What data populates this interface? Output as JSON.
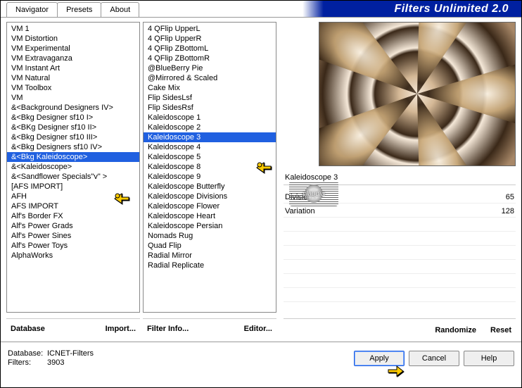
{
  "app": {
    "title": "Filters Unlimited 2.0"
  },
  "tabs": [
    "Navigator",
    "Presets",
    "About"
  ],
  "activeTab": 0,
  "categories": [
    "VM 1",
    "VM Distortion",
    "VM Experimental",
    "VM Extravaganza",
    "VM Instant Art",
    "VM Natural",
    "VM Toolbox",
    "VM",
    "&<Background Designers IV>",
    "&<Bkg Designer sf10 I>",
    "&<BKg Designer sf10 II>",
    "&<Bkg Designer sf10 III>",
    "&<Bkg Designers sf10 IV>",
    "&<Bkg Kaleidoscope>",
    "&<Kaleidoscope>",
    "&<Sandflower Specials\"v\" >",
    "[AFS IMPORT]",
    "AFH",
    "AFS IMPORT",
    "Alf's Border FX",
    "Alf's Power Grads",
    "Alf's Power Sines",
    "Alf's Power Toys",
    "AlphaWorks"
  ],
  "selectedCategoryIndex": 13,
  "filters": [
    "4 QFlip UpperL",
    "4 QFlip UpperR",
    "4 QFlip ZBottomL",
    "4 QFlip ZBottomR",
    "@BlueBerry Pie",
    "@Mirrored & Scaled",
    "Cake Mix",
    "Flip SidesLsf",
    "Flip SidesRsf",
    "Kaleidoscope 1",
    "Kaleidoscope 2",
    "Kaleidoscope 3",
    "Kaleidoscope 4",
    "Kaleidoscope 5",
    "Kaleidoscope 8",
    "Kaleidoscope 9",
    "Kaleidoscope Butterfly",
    "Kaleidoscope Divisions",
    "Kaleidoscope Flower",
    "Kaleidoscope Heart",
    "Kaleidoscope Persian",
    "Nomads Rug",
    "Quad Flip",
    "Radial Mirror",
    "Radial Replicate"
  ],
  "selectedFilterIndex": 11,
  "currentFilterLabel": "Kaleidoscope 3",
  "params": [
    {
      "name": "Divisions",
      "value": "65"
    },
    {
      "name": "Variation",
      "value": "128"
    }
  ],
  "emptyParamRows": 6,
  "buttons": {
    "database": "Database",
    "import": "Import...",
    "filterInfo": "Filter Info...",
    "editor": "Editor...",
    "randomize": "Randomize",
    "reset": "Reset",
    "apply": "Apply",
    "cancel": "Cancel",
    "help": "Help"
  },
  "status": {
    "dbLabel": "Database:",
    "dbValue": "ICNET-Filters",
    "filtersLabel": "Filters:",
    "filtersValue": "3903"
  },
  "watermark": "claudia"
}
